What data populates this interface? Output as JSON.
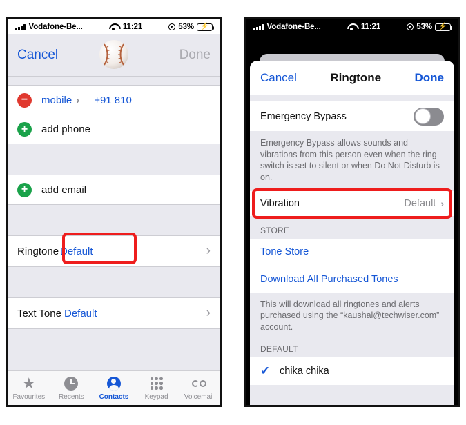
{
  "status_bar": {
    "carrier": "Vodafone-Be...",
    "time": "11:21",
    "battery_percent": "53%",
    "signal_icon": "signal-bars-icon",
    "wifi_icon": "wifi-icon",
    "location_icon": "location-services-icon",
    "battery_icon": "battery-charging-icon",
    "battery_fill_color": "#f0b323"
  },
  "left_phone": {
    "nav": {
      "cancel_label": "Cancel",
      "done_label": "Done",
      "avatar_icon": "baseball-avatar"
    },
    "rows": {
      "phone_type_label": "mobile",
      "phone_number": "+91 810",
      "add_phone_label": "add phone",
      "add_email_label": "add email",
      "ringtone_label": "Ringtone",
      "ringtone_value": "Default",
      "text_tone_label": "Text Tone",
      "text_tone_value": "Default"
    },
    "highlight_color": "#ee1d1d",
    "tabs": [
      {
        "label": "Favourites",
        "icon": "star-icon",
        "active": false
      },
      {
        "label": "Recents",
        "icon": "clock-icon",
        "active": false
      },
      {
        "label": "Contacts",
        "icon": "contact-person-icon",
        "active": true
      },
      {
        "label": "Keypad",
        "icon": "keypad-dots-icon",
        "active": false
      },
      {
        "label": "Voicemail",
        "icon": "voicemail-tape-icon",
        "active": false
      }
    ]
  },
  "right_phone": {
    "nav": {
      "cancel_label": "Cancel",
      "title": "Ringtone",
      "done_label": "Done"
    },
    "emergency_bypass": {
      "label": "Emergency Bypass",
      "toggle_state": "off",
      "footer": "Emergency Bypass allows sounds and vibrations from this person even when the ring switch is set to silent or when Do Not Disturb is on."
    },
    "vibration": {
      "label": "Vibration",
      "value": "Default"
    },
    "store": {
      "header": "STORE",
      "tone_store_label": "Tone Store",
      "download_label": "Download All Purchased Tones",
      "footer": "This will download all ringtones and alerts purchased using the “kaushal@techwiser.com” account."
    },
    "default_section": {
      "header": "DEFAULT",
      "tone_label": "chika chika",
      "selected": true,
      "check_icon": "checkmark-icon"
    },
    "highlight_color": "#ee1d1d"
  }
}
